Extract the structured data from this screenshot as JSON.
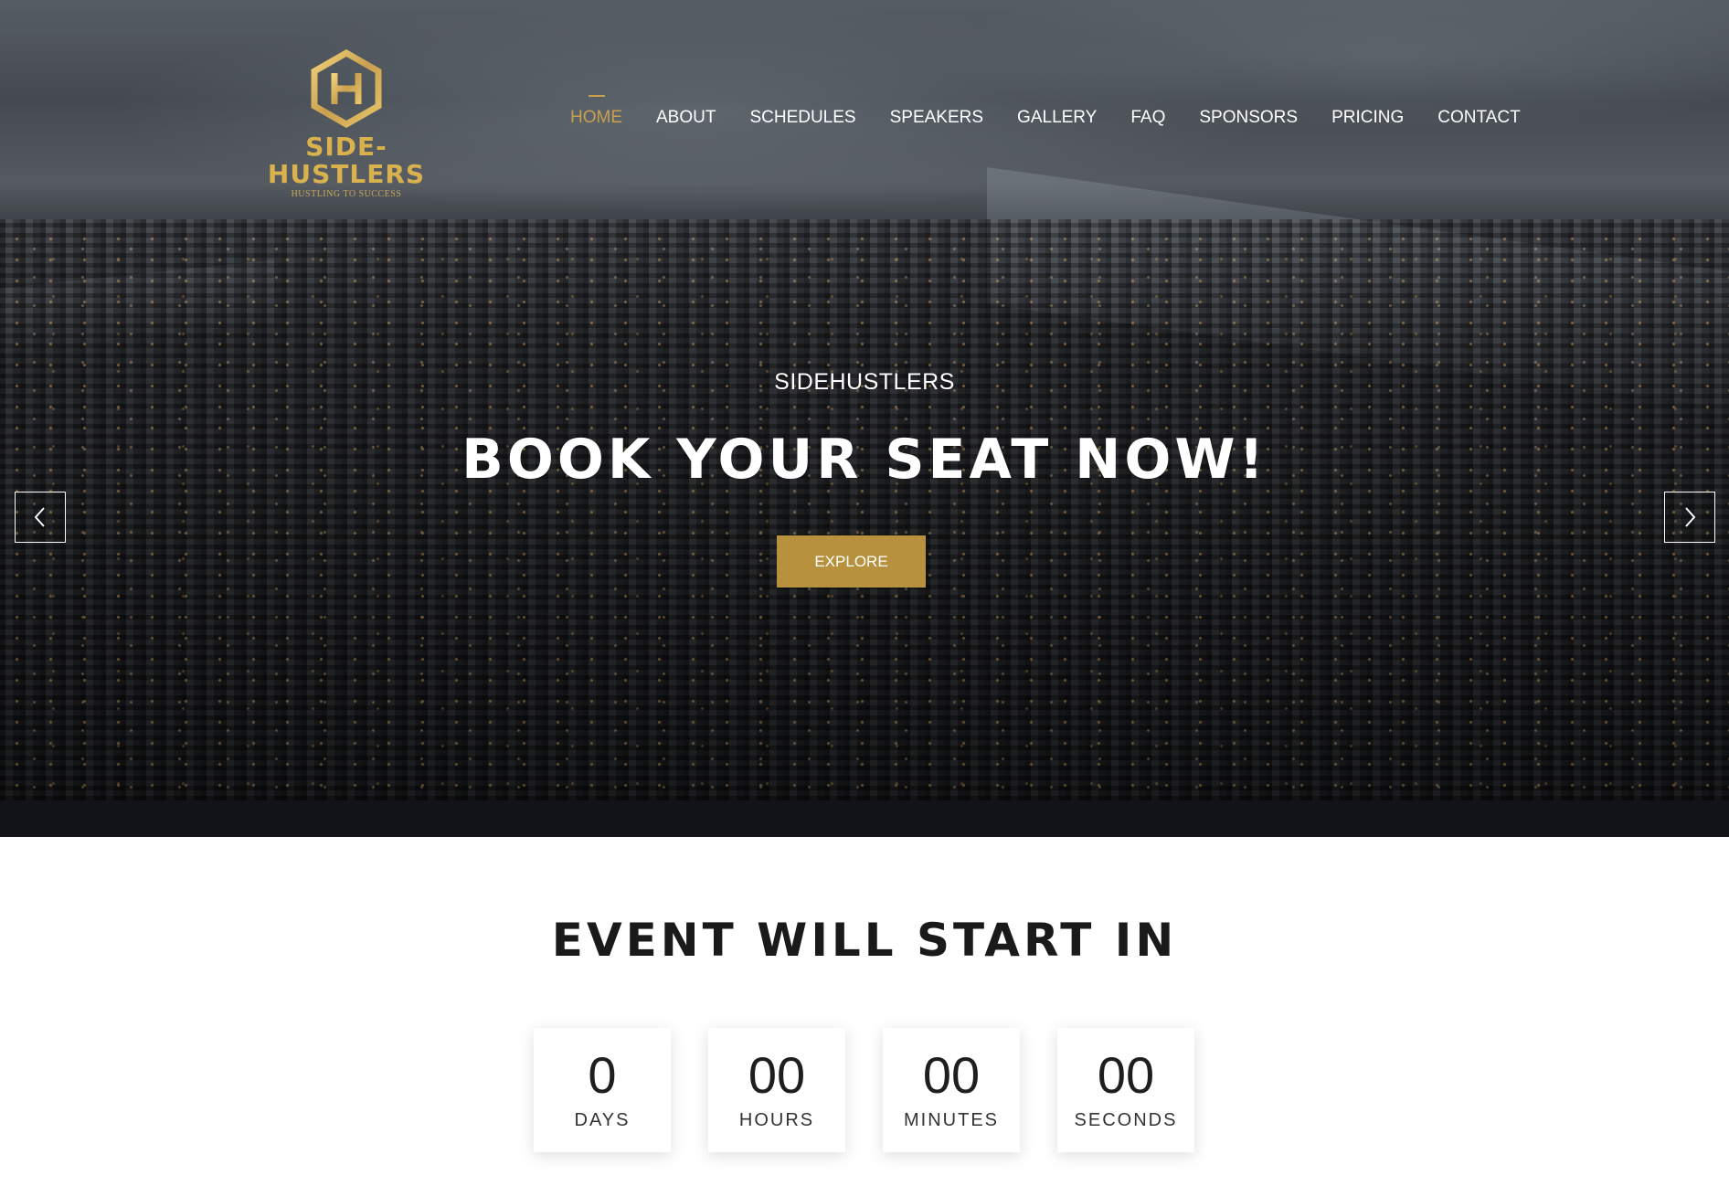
{
  "brand": {
    "name": "SIDE-HUSTLERS",
    "tagline": "HUSTLING TO SUCCESS",
    "accent_color": "#c9a04f"
  },
  "nav": {
    "items": [
      {
        "label": "HOME",
        "active": true
      },
      {
        "label": "ABOUT"
      },
      {
        "label": "SCHEDULES"
      },
      {
        "label": "SPEAKERS"
      },
      {
        "label": "GALLERY"
      },
      {
        "label": "FAQ"
      },
      {
        "label": "SPONSORS"
      },
      {
        "label": "PRICING"
      },
      {
        "label": "CONTACT"
      }
    ]
  },
  "hero": {
    "kicker": "SIDEHUSTLERS",
    "title": "BOOK YOUR SEAT NOW!",
    "cta_label": "EXPLORE",
    "prev_icon": "chevron-left-icon",
    "next_icon": "chevron-right-icon"
  },
  "countdown": {
    "title": "EVENT WILL START IN",
    "units": [
      {
        "value": "0",
        "label": "DAYS"
      },
      {
        "value": "00",
        "label": "HOURS"
      },
      {
        "value": "00",
        "label": "MINUTES"
      },
      {
        "value": "00",
        "label": "SECONDS"
      }
    ]
  }
}
